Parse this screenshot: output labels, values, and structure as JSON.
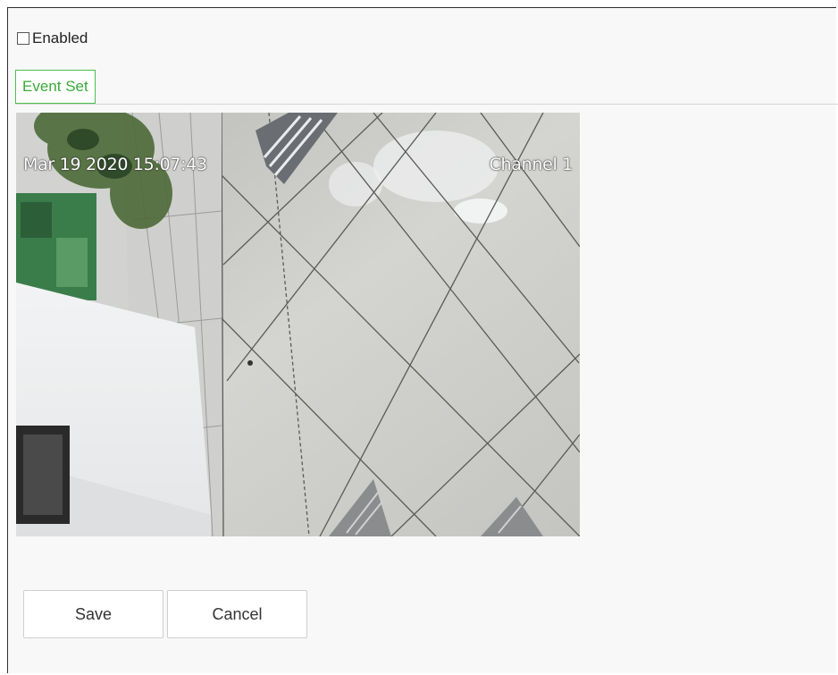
{
  "settings": {
    "enabled_label": "Enabled",
    "enabled_checked": false,
    "tab_label": "Event Set"
  },
  "preview": {
    "timestamp": "Mar 19 2020 15:07:43",
    "channel": "Channel 1"
  },
  "actions": {
    "save_label": "Save",
    "cancel_label": "Cancel"
  },
  "colors": {
    "accent": "#3aaa3a",
    "tab_border": "#4cbd4f"
  }
}
